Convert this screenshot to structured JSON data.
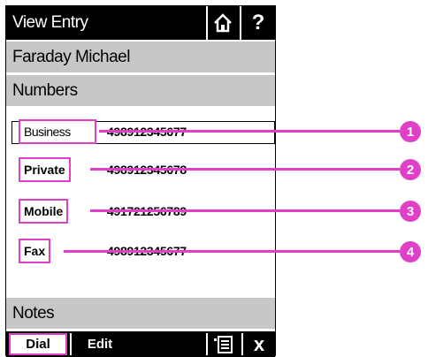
{
  "title_bar": {
    "title": "View Entry",
    "home_icon": "home-icon",
    "help_label": "?"
  },
  "contact": {
    "name": "Faraday Michael"
  },
  "numbers_section": {
    "heading": "Numbers"
  },
  "numbers": [
    {
      "label": "Business",
      "value": "498912345677",
      "callout": "1"
    },
    {
      "label": "Private",
      "value": "498912345678",
      "callout": "2"
    },
    {
      "label": "Mobile",
      "value": "491721256789",
      "callout": "3"
    },
    {
      "label": "Fax",
      "value": "498912345677",
      "callout": "4"
    }
  ],
  "notes_section": {
    "heading": "Notes"
  },
  "softkeys": {
    "dial": "Dial",
    "edit": "Edit",
    "menu_icon": "menu-icon",
    "close": "x"
  },
  "colors": {
    "highlight": "#e040c8",
    "bar_gray": "#c7c7c7",
    "title_bg": "#000000"
  }
}
